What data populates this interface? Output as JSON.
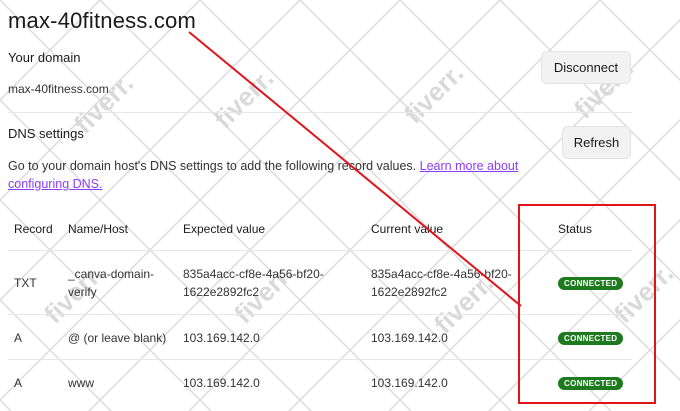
{
  "domain": "max-40fitness.com",
  "your_domain": {
    "heading": "Your domain",
    "value": "max-40fitness.com",
    "disconnect_label": "Disconnect"
  },
  "dns": {
    "heading": "DNS settings",
    "refresh_label": "Refresh",
    "description": "Go to your domain host's DNS settings to add the following record values.",
    "learn_more": "Learn more about configuring DNS."
  },
  "table": {
    "headers": [
      "Record",
      "Name/Host",
      "Expected value",
      "Current value",
      "Status"
    ],
    "rows": [
      {
        "record": "TXT",
        "name_line1": "_canva-domain-",
        "name_line2": "verify",
        "expected_line1": "835a4acc-cf8e-4a56-bf20-",
        "expected_line2": "1622e2892fc2",
        "current_line1": "835a4acc-cf8e-4a56-bf20-",
        "current_line2": "1622e2892fc2",
        "status": "CONNECTED"
      },
      {
        "record": "A",
        "name_line1": "@ (or leave blank)",
        "expected_line1": "103.169.142.0",
        "current_line1": "103.169.142.0",
        "status": "CONNECTED"
      },
      {
        "record": "A",
        "name_line1": "www",
        "expected_line1": "103.169.142.0",
        "current_line1": "103.169.142.0",
        "status": "CONNECTED"
      }
    ]
  },
  "colors": {
    "accent_link": "#8b3dff",
    "status_green": "#1e7a1e",
    "annotation_red": "#e0141c"
  },
  "watermark": "fiverr."
}
